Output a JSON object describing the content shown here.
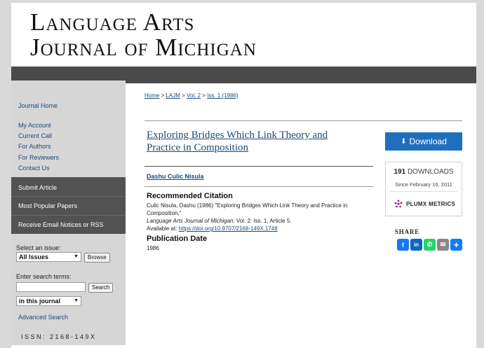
{
  "masthead": {
    "line1": "Language Arts",
    "line2": "Journal of Michigan"
  },
  "sidebar": {
    "top_links": [
      {
        "label": "Journal Home"
      },
      {
        "label": "My Account"
      },
      {
        "label": "Current Call"
      },
      {
        "label": "For Authors"
      },
      {
        "label": "For Reviewers"
      },
      {
        "label": "Contact Us"
      }
    ],
    "dark_menu": [
      {
        "label": "Submit Article"
      },
      {
        "label": "Most Popular Papers"
      },
      {
        "label": "Receive Email Notices or RSS"
      }
    ],
    "issue_label": "Select an issue:",
    "issue_select": "All Issues",
    "browse_button": "Browse",
    "search_label": "Enter search terms:",
    "search_value": "",
    "search_button": "Search",
    "scope_select": "in this journal",
    "advanced_search": "Advanced Search",
    "issn": "ISSN: 2168-149X"
  },
  "breadcrumb": {
    "home": "Home",
    "sep1": " > ",
    "journal": "LAJM",
    "sep2": " > ",
    "volume": "Vol. 2",
    "sep3": " > ",
    "issue": "Iss. 1 (1986)"
  },
  "article": {
    "title": "Exploring Bridges Which Link Theory and Practice in Composition",
    "author": "Dashu Culic Nisula",
    "citation_heading": "Recommended Citation",
    "citation_line1": "Culic Nisula, Dashu (1986) \"Exploring Bridges Which Link Theory and Practice in Composition,\"",
    "citation_journal": "Language Arts Journal of Michigan",
    "citation_rest": ": Vol. 2: Iss. 1, Article 5.",
    "citation_avail": "Available at: ",
    "citation_doi": "https://doi.org/10.9707/2168-149X.1748",
    "pubdate_heading": "Publication Date",
    "pubdate": "1986"
  },
  "download": {
    "label": "Download",
    "count": "191",
    "count_label": " DOWNLOADS",
    "since": "Since February 16, 2011",
    "plumx": "PLUMX METRICS"
  },
  "share": {
    "label": "SHARE",
    "icons": [
      {
        "name": "facebook",
        "glyph": "f",
        "color": "#1877f2"
      },
      {
        "name": "linkedin",
        "glyph": "in",
        "color": "#0a66c2"
      },
      {
        "name": "whatsapp",
        "glyph": "✆",
        "color": "#25d366"
      },
      {
        "name": "email",
        "glyph": "✉",
        "color": "#888888"
      },
      {
        "name": "share",
        "glyph": "+",
        "color": "#0e7cff"
      }
    ]
  }
}
